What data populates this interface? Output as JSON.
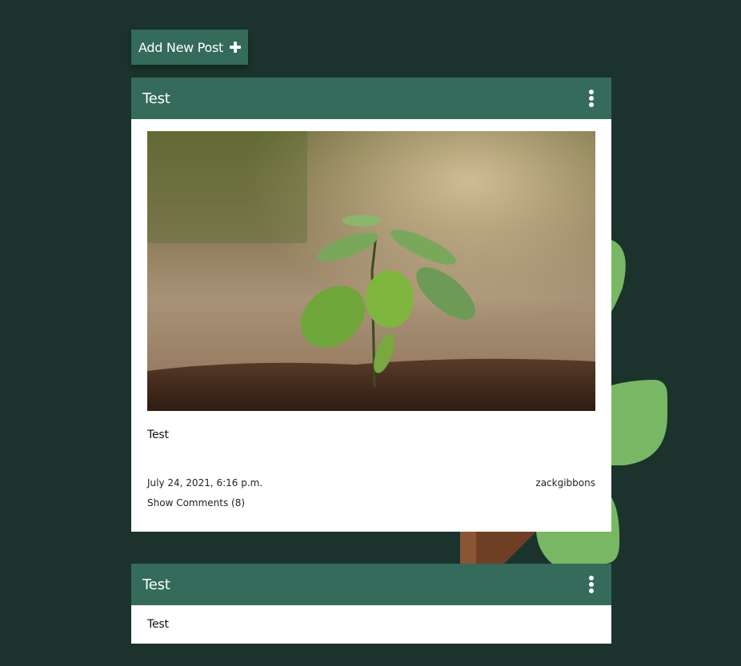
{
  "toolbar": {
    "add_post_label": "Add New Post",
    "add_post_icon": "plus-icon"
  },
  "posts": [
    {
      "title": "Test",
      "menu_icon": "kebab-menu-icon",
      "image": "seedling-photo",
      "body": "Test",
      "date": "July 24, 2021, 6:16 p.m.",
      "author": "zackgibbons",
      "comments_label": "Show Comments (8)"
    },
    {
      "title": "Test",
      "menu_icon": "kebab-menu-icon",
      "body": "Test"
    }
  ],
  "colors": {
    "background": "#1b332c",
    "header_accent": "#346b5a",
    "leaf_green": "#78b864",
    "trunk_brown": "#7a4a2e"
  }
}
